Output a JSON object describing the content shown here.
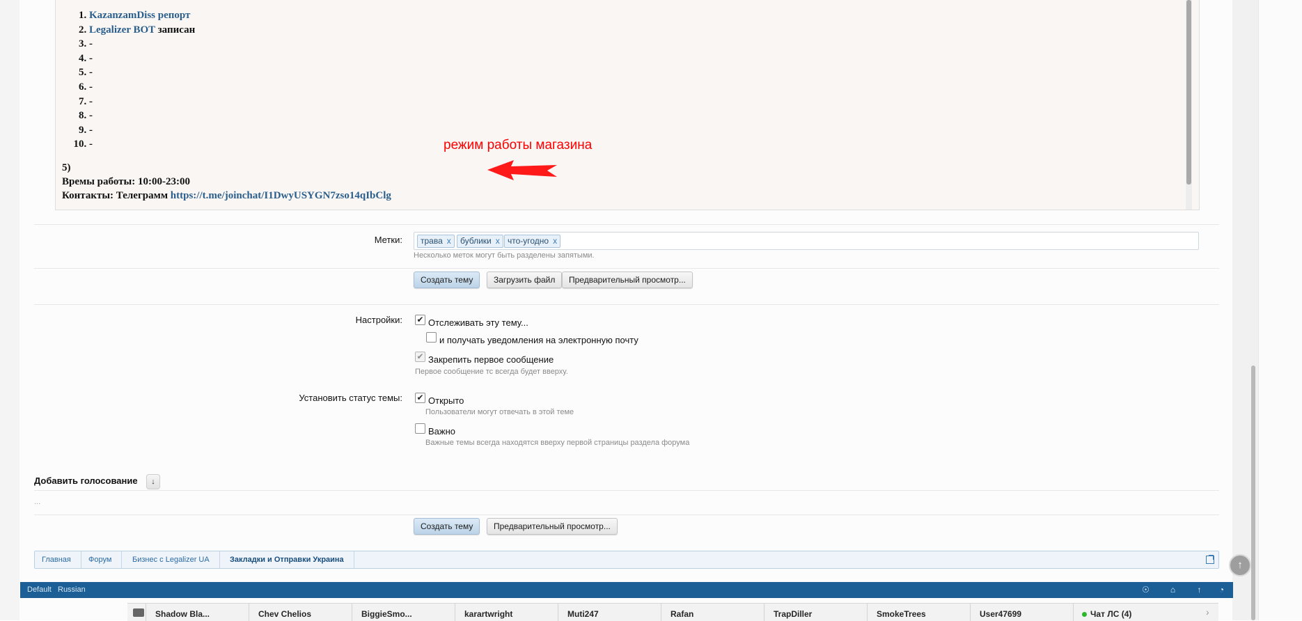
{
  "editor": {
    "list": [
      {
        "link": "KazanzamDiss репорт",
        "tail": ""
      },
      {
        "link": "Legalizer BOT",
        "tail": " записан"
      },
      {
        "link": "",
        "tail": "-"
      },
      {
        "link": "",
        "tail": "-"
      },
      {
        "link": "",
        "tail": "-"
      },
      {
        "link": "",
        "tail": "-"
      },
      {
        "link": "",
        "tail": "-"
      },
      {
        "link": "",
        "tail": "-"
      },
      {
        "link": "",
        "tail": "-"
      },
      {
        "link": "",
        "tail": "-"
      }
    ],
    "section_number": "5)",
    "hours_line": "Времы работы: 10:00-23:00",
    "contacts_prefix": "Контакты: Телеграмм ",
    "contacts_link": "https://t.me/joinchat/I1DwyUSYGN7zso14qIbClg",
    "annotation": "режим работы магазина",
    "annotation_color": "#ff0000"
  },
  "tags": {
    "label": "Метки:",
    "items": [
      "трава",
      "бублики",
      "что-угодно"
    ],
    "remove_glyph": "x",
    "hint": "Несколько меток могут быть разделены запятыми."
  },
  "actions_top": {
    "create": "Создать тему",
    "upload": "Загрузить файл",
    "preview": "Предварительный просмотр..."
  },
  "settings": {
    "label": "Настройки:",
    "watch": {
      "label": "Отслеживать эту тему...",
      "checked": true
    },
    "email": {
      "label": "и получать уведомления на электронную почту",
      "checked": false
    },
    "pin": {
      "label": "Закрепить первое сообщение",
      "checked": true,
      "hint": "Первое сообщение тс всегда будет вверху."
    }
  },
  "status": {
    "label": "Установить статус темы:",
    "open": {
      "label": "Открыто",
      "checked": true,
      "hint": "Пользователи могут отвечать в этой теме"
    },
    "important": {
      "label": "Важно",
      "checked": false,
      "hint": "Важные темы всегда находятся вверху первой страницы раздела форума"
    }
  },
  "poll": {
    "title": "Добавить голосование",
    "toggle": "↓",
    "placeholder": "..."
  },
  "actions_bottom": {
    "create": "Создать тему",
    "preview": "Предварительный просмотр..."
  },
  "breadcrumb": [
    "Главная",
    "Форум",
    "Бизнес с Legalizer UA",
    "Закладки и Отправки Украина"
  ],
  "footer": {
    "style": "Default",
    "language": "Russian"
  },
  "online": {
    "users": [
      "Shadow Bla...",
      "Chev Chelios",
      "BiggieSmo...",
      "karartwright",
      "Muti247",
      "Rafan",
      "TrapDiller",
      "SmokeTrees",
      "User47699"
    ],
    "chat": "Чат ЛС (4)"
  },
  "colors": {
    "accent": "#1c5e96",
    "link": "#2a5e8c",
    "online_dot": "#2db52d"
  }
}
